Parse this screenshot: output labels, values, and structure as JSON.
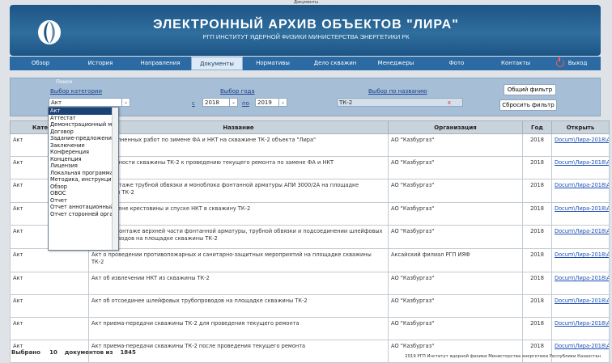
{
  "window_title": "Документы",
  "header": {
    "title": "ЭЛЕКТРОННЫЙ  АРХИВ  ОБЪЕКТОВ \"ЛИРА\"",
    "subtitle": "РГП ИНСТИТУТ ЯДЕРНОЙ ФИЗИКИ МИНИСТЕРСТВА ЭНЕРГЕТИКИ РК"
  },
  "nav": [
    "Обзор",
    "История",
    "Направления",
    "Документы",
    "Нормативы",
    "Дело скважин",
    "Менеджеры",
    "Фото",
    "Контакты",
    "Выход"
  ],
  "filters": {
    "legend": "Поиск",
    "category_label": "Выбор категории",
    "category_value": "Акт",
    "year_label": "Выбор года",
    "from_label": "с",
    "from_year": "2018",
    "to_label": "по",
    "to_year": "2019",
    "name_label": "Выбор по названию",
    "name_value": "ТК-2",
    "clear_glyph": "x",
    "general_filter": "Общий фильтр",
    "reset_filter": "Сбросить фильтр"
  },
  "dropdown_items": [
    "Акт",
    "Аттестат",
    "Демонстрационный мат",
    "Договор",
    "Задание-предложение",
    "Заключение",
    "Конференция",
    "Концепция",
    "Лицензия",
    "Локальная программа",
    "Методика, инструкция",
    "Обзор",
    "ОВОС",
    "Отчет",
    "Отчет аннотационный",
    "Отчет сторонней органи"
  ],
  "table": {
    "headers": [
      "Категория",
      "Название",
      "Организация",
      "Год",
      "Открыть"
    ],
    "rows": [
      [
        "Акт",
        "Акт выполненных работ по зимене ФА и НКТ на скважине ТК-2 объекта \"Лира\"",
        "АО \"Казбургаз\"",
        "2018",
        "Docum\\Лира-2018\\Акт-"
      ],
      [
        "Акт",
        "Акт готовности скважины ТК-2 к проведению текущего ремонта по замене ФА и НКТ",
        "АО \"Казбургаз\"",
        "2018",
        "Docum\\Лира-2018\\Акт-"
      ],
      [
        "Акт",
        "Акт о монтаже трубной обвязки и моноблока фонтанной арматуры АПИ 3000/2А на площадке скважины ТК-2",
        "АО \"Казбургаз\"",
        "2018",
        "Docum\\Лира-2018\\Акт-"
      ],
      [
        "Акт",
        "Акт о замене крестовины и спуске НКТ в скважину ТК-2",
        "АО \"Казбургаз\"",
        "2018",
        "Docum\\Лира-2018\\Акт-"
      ],
      [
        "Акт",
        "Акт о демонтаже верхней части фонтанной арматуры, трубной обвязки и подсоединении шлейфовых трубопроводов на площадке скважины ТК-2",
        "АО \"Казбургаз\"",
        "2018",
        "Docum\\Лира-2018\\Акт-"
      ],
      [
        "Акт",
        "Акт о проведении противопожарных и санитарно-защитных мероприятий на площадке скважины ТК-2",
        "Аксайский филиал РГП ИЯФ",
        "2018",
        "Docum\\Лира-2018\\Акт-"
      ],
      [
        "Акт",
        "Акт об извлечении НКТ из скважины ТК-2",
        "АО \"Казбургаз\"",
        "2018",
        "Docum\\Лира-2018\\Акт-"
      ],
      [
        "Акт",
        "Акт об отсоединее шлейфовых трубопроводов на площадке скважины ТК-2",
        "АО \"Казбургаз\"",
        "2018",
        "Docum\\Лира-2018\\Акт-"
      ],
      [
        "Акт",
        "Акт приема-передачи скважины ТК-2 для проведения текущего ремонта",
        "АО \"Казбургаз\"",
        "2018",
        "Docum\\Лира-2018\\Акт-"
      ],
      [
        "Акт",
        "Акт приема-передачи скважины ТК-2 после проведения текущего ремонта",
        "АО \"Казбургаз\"",
        "2018",
        "Docum\\Лира-2018\\Акт-"
      ]
    ]
  },
  "footer": {
    "selected_label": "Выбрано",
    "selected": "10",
    "of_label": "документов из",
    "total": "1845",
    "copyright": "2019  РГП Институт ядерной физики Министерства энергетики Республики Казахстан"
  },
  "colors": {
    "banner": "#2f6e9e",
    "nav": "#2c6aa4",
    "filter_panel": "#a6bfd6",
    "accent_red": "#e03030"
  }
}
